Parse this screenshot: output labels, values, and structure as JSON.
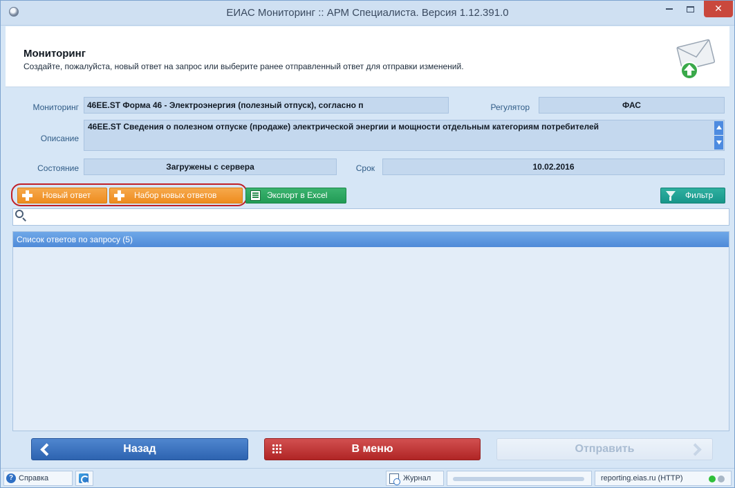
{
  "window": {
    "title": "ЕИАС Мониторинг :: АРМ Специалиста. Версия 1.12.391.0"
  },
  "header": {
    "title": "Мониторинг",
    "subtitle": "Создайте, пожалуйста, новый ответ на запрос или выберите ранее отправленный ответ для отправки изменений.",
    "icon": "mail-upload-icon"
  },
  "form": {
    "monitoring_label": "Мониторинг",
    "monitoring_value": "46EE.ST  Форма 46 - Электроэнергия (полезный отпуск), согласно п",
    "regulator_label": "Регулятор",
    "regulator_value": "ФАС",
    "description_label": "Описание",
    "description_value": "46EE.ST  Сведения о полезном отпуске (продаже) электрической энергии и мощности отдельным категориям потребителей",
    "state_label": "Состояние",
    "state_value": "Загружены с сервера",
    "deadline_label": "Срок",
    "deadline_value": "10.02.2016"
  },
  "toolbar": {
    "new_answer": "Новый ответ",
    "new_answers_set": "Набор новых ответов",
    "export_excel": "Экспорт в Excel",
    "filter": "Фильтр"
  },
  "search": {
    "value": "",
    "placeholder": ""
  },
  "list": {
    "header": "Список ответов по запросу (5)"
  },
  "nav": {
    "back": "Назад",
    "menu": "В меню",
    "send": "Отправить"
  },
  "statusbar": {
    "help": "Справка",
    "journal": "Журнал",
    "server": "reporting.eias.ru (HTTP)"
  },
  "colors": {
    "accent_blue": "#4f8ad8",
    "orange": "#ee8c1f",
    "green": "#219b55",
    "red": "#b02525",
    "highlight_ring": "#c01f26",
    "status_green": "#2fbf3a",
    "status_gray": "#a9b7c6"
  }
}
